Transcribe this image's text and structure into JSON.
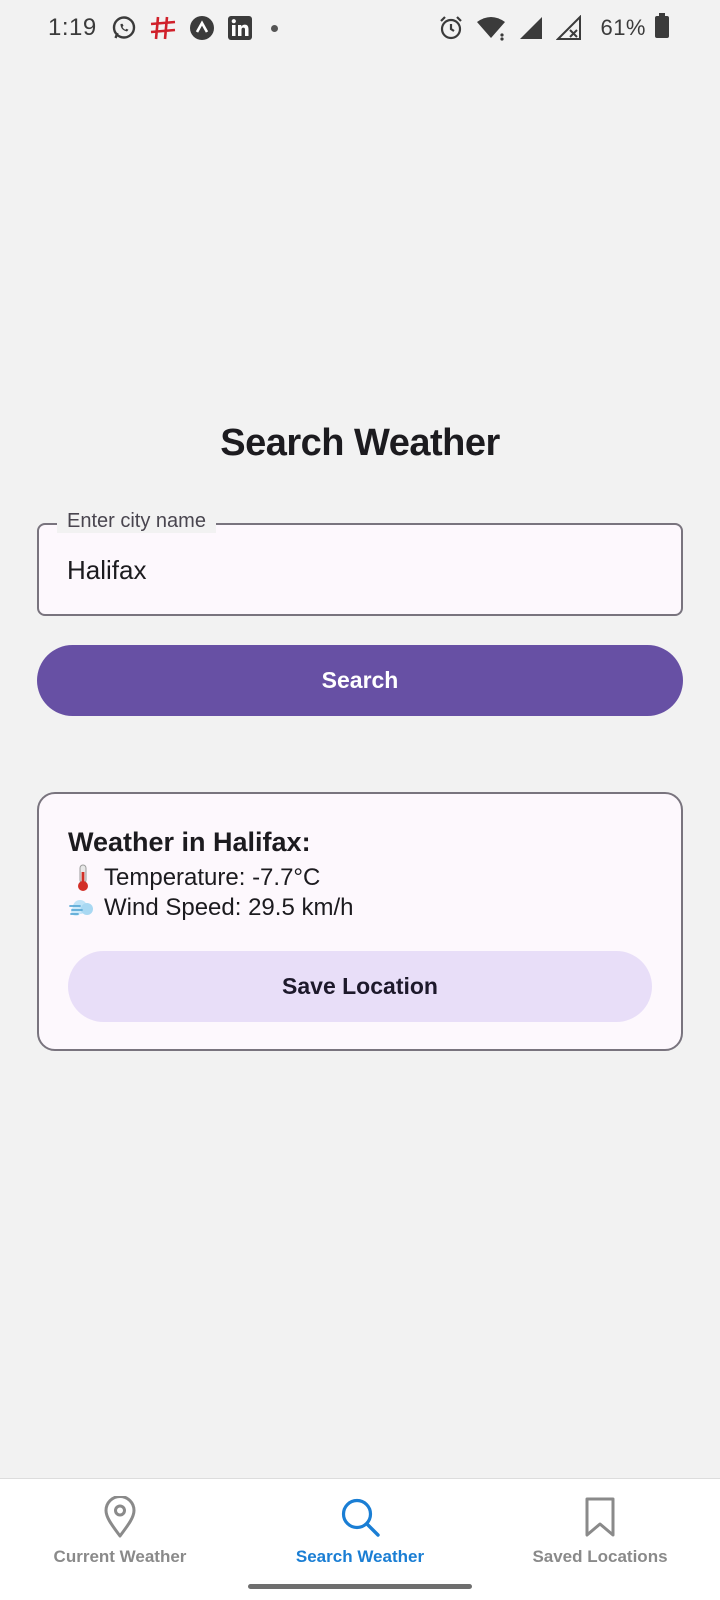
{
  "status_bar": {
    "time": "1:19",
    "left_icons": [
      "whatsapp-icon",
      "hashtag-app-icon",
      "expo-icon",
      "linkedin-icon",
      "notification-dot-icon"
    ],
    "right_icons": [
      "alarm-icon",
      "wifi-icon",
      "signal-icon",
      "signal-no-data-icon",
      "battery-icon"
    ],
    "battery_percent": "61%"
  },
  "page": {
    "title": "Search Weather"
  },
  "search": {
    "label": "Enter city name",
    "value": "Halifax",
    "button_label": "Search"
  },
  "weather_card": {
    "heading": "Weather in Halifax:",
    "temperature_icon": "🌡️",
    "temperature_text": "Temperature: -7.7°C",
    "wind_icon": "💨",
    "wind_text": "Wind Speed: 29.5 km/h",
    "save_label": "Save Location"
  },
  "bottom_nav": {
    "items": [
      {
        "label": "Current Weather",
        "icon": "map-pin-icon",
        "active": false
      },
      {
        "label": "Search Weather",
        "icon": "search-icon",
        "active": true
      },
      {
        "label": "Saved Locations",
        "icon": "bookmark-icon",
        "active": false
      }
    ]
  },
  "colors": {
    "primary": "#6750a4",
    "secondary_container": "#e8def8",
    "nav_active": "#1a7ed4",
    "nav_inactive": "#8a8a8a",
    "background": "#f2f2f2"
  }
}
